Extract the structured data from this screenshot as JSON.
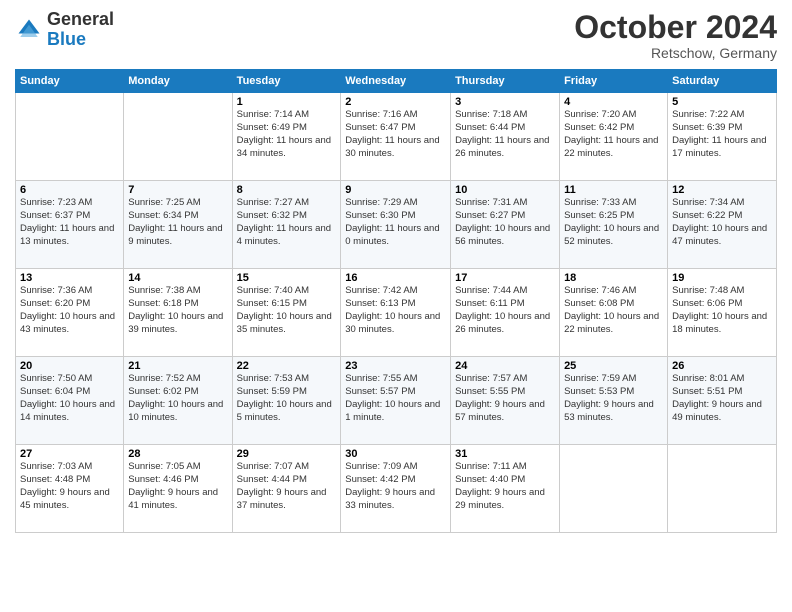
{
  "logo": {
    "general": "General",
    "blue": "Blue"
  },
  "header": {
    "month": "October 2024",
    "location": "Retschow, Germany"
  },
  "weekdays": [
    "Sunday",
    "Monday",
    "Tuesday",
    "Wednesday",
    "Thursday",
    "Friday",
    "Saturday"
  ],
  "weeks": [
    [
      {
        "day": "",
        "sunrise": "",
        "sunset": "",
        "daylight": ""
      },
      {
        "day": "",
        "sunrise": "",
        "sunset": "",
        "daylight": ""
      },
      {
        "day": "1",
        "sunrise": "Sunrise: 7:14 AM",
        "sunset": "Sunset: 6:49 PM",
        "daylight": "Daylight: 11 hours and 34 minutes."
      },
      {
        "day": "2",
        "sunrise": "Sunrise: 7:16 AM",
        "sunset": "Sunset: 6:47 PM",
        "daylight": "Daylight: 11 hours and 30 minutes."
      },
      {
        "day": "3",
        "sunrise": "Sunrise: 7:18 AM",
        "sunset": "Sunset: 6:44 PM",
        "daylight": "Daylight: 11 hours and 26 minutes."
      },
      {
        "day": "4",
        "sunrise": "Sunrise: 7:20 AM",
        "sunset": "Sunset: 6:42 PM",
        "daylight": "Daylight: 11 hours and 22 minutes."
      },
      {
        "day": "5",
        "sunrise": "Sunrise: 7:22 AM",
        "sunset": "Sunset: 6:39 PM",
        "daylight": "Daylight: 11 hours and 17 minutes."
      }
    ],
    [
      {
        "day": "6",
        "sunrise": "Sunrise: 7:23 AM",
        "sunset": "Sunset: 6:37 PM",
        "daylight": "Daylight: 11 hours and 13 minutes."
      },
      {
        "day": "7",
        "sunrise": "Sunrise: 7:25 AM",
        "sunset": "Sunset: 6:34 PM",
        "daylight": "Daylight: 11 hours and 9 minutes."
      },
      {
        "day": "8",
        "sunrise": "Sunrise: 7:27 AM",
        "sunset": "Sunset: 6:32 PM",
        "daylight": "Daylight: 11 hours and 4 minutes."
      },
      {
        "day": "9",
        "sunrise": "Sunrise: 7:29 AM",
        "sunset": "Sunset: 6:30 PM",
        "daylight": "Daylight: 11 hours and 0 minutes."
      },
      {
        "day": "10",
        "sunrise": "Sunrise: 7:31 AM",
        "sunset": "Sunset: 6:27 PM",
        "daylight": "Daylight: 10 hours and 56 minutes."
      },
      {
        "day": "11",
        "sunrise": "Sunrise: 7:33 AM",
        "sunset": "Sunset: 6:25 PM",
        "daylight": "Daylight: 10 hours and 52 minutes."
      },
      {
        "day": "12",
        "sunrise": "Sunrise: 7:34 AM",
        "sunset": "Sunset: 6:22 PM",
        "daylight": "Daylight: 10 hours and 47 minutes."
      }
    ],
    [
      {
        "day": "13",
        "sunrise": "Sunrise: 7:36 AM",
        "sunset": "Sunset: 6:20 PM",
        "daylight": "Daylight: 10 hours and 43 minutes."
      },
      {
        "day": "14",
        "sunrise": "Sunrise: 7:38 AM",
        "sunset": "Sunset: 6:18 PM",
        "daylight": "Daylight: 10 hours and 39 minutes."
      },
      {
        "day": "15",
        "sunrise": "Sunrise: 7:40 AM",
        "sunset": "Sunset: 6:15 PM",
        "daylight": "Daylight: 10 hours and 35 minutes."
      },
      {
        "day": "16",
        "sunrise": "Sunrise: 7:42 AM",
        "sunset": "Sunset: 6:13 PM",
        "daylight": "Daylight: 10 hours and 30 minutes."
      },
      {
        "day": "17",
        "sunrise": "Sunrise: 7:44 AM",
        "sunset": "Sunset: 6:11 PM",
        "daylight": "Daylight: 10 hours and 26 minutes."
      },
      {
        "day": "18",
        "sunrise": "Sunrise: 7:46 AM",
        "sunset": "Sunset: 6:08 PM",
        "daylight": "Daylight: 10 hours and 22 minutes."
      },
      {
        "day": "19",
        "sunrise": "Sunrise: 7:48 AM",
        "sunset": "Sunset: 6:06 PM",
        "daylight": "Daylight: 10 hours and 18 minutes."
      }
    ],
    [
      {
        "day": "20",
        "sunrise": "Sunrise: 7:50 AM",
        "sunset": "Sunset: 6:04 PM",
        "daylight": "Daylight: 10 hours and 14 minutes."
      },
      {
        "day": "21",
        "sunrise": "Sunrise: 7:52 AM",
        "sunset": "Sunset: 6:02 PM",
        "daylight": "Daylight: 10 hours and 10 minutes."
      },
      {
        "day": "22",
        "sunrise": "Sunrise: 7:53 AM",
        "sunset": "Sunset: 5:59 PM",
        "daylight": "Daylight: 10 hours and 5 minutes."
      },
      {
        "day": "23",
        "sunrise": "Sunrise: 7:55 AM",
        "sunset": "Sunset: 5:57 PM",
        "daylight": "Daylight: 10 hours and 1 minute."
      },
      {
        "day": "24",
        "sunrise": "Sunrise: 7:57 AM",
        "sunset": "Sunset: 5:55 PM",
        "daylight": "Daylight: 9 hours and 57 minutes."
      },
      {
        "day": "25",
        "sunrise": "Sunrise: 7:59 AM",
        "sunset": "Sunset: 5:53 PM",
        "daylight": "Daylight: 9 hours and 53 minutes."
      },
      {
        "day": "26",
        "sunrise": "Sunrise: 8:01 AM",
        "sunset": "Sunset: 5:51 PM",
        "daylight": "Daylight: 9 hours and 49 minutes."
      }
    ],
    [
      {
        "day": "27",
        "sunrise": "Sunrise: 7:03 AM",
        "sunset": "Sunset: 4:48 PM",
        "daylight": "Daylight: 9 hours and 45 minutes."
      },
      {
        "day": "28",
        "sunrise": "Sunrise: 7:05 AM",
        "sunset": "Sunset: 4:46 PM",
        "daylight": "Daylight: 9 hours and 41 minutes."
      },
      {
        "day": "29",
        "sunrise": "Sunrise: 7:07 AM",
        "sunset": "Sunset: 4:44 PM",
        "daylight": "Daylight: 9 hours and 37 minutes."
      },
      {
        "day": "30",
        "sunrise": "Sunrise: 7:09 AM",
        "sunset": "Sunset: 4:42 PM",
        "daylight": "Daylight: 9 hours and 33 minutes."
      },
      {
        "day": "31",
        "sunrise": "Sunrise: 7:11 AM",
        "sunset": "Sunset: 4:40 PM",
        "daylight": "Daylight: 9 hours and 29 minutes."
      },
      {
        "day": "",
        "sunrise": "",
        "sunset": "",
        "daylight": ""
      },
      {
        "day": "",
        "sunrise": "",
        "sunset": "",
        "daylight": ""
      }
    ]
  ]
}
